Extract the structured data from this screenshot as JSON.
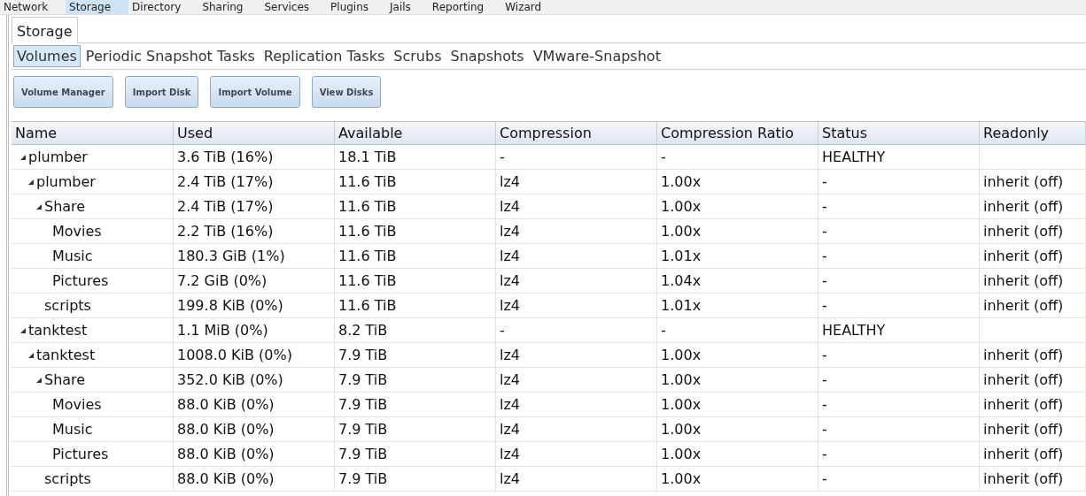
{
  "top_nav": [
    {
      "label": "Network",
      "selected": false
    },
    {
      "label": "Storage",
      "selected": true
    },
    {
      "label": "Directory",
      "selected": false
    },
    {
      "label": "Sharing",
      "selected": false
    },
    {
      "label": "Services",
      "selected": false
    },
    {
      "label": "Plugins",
      "selected": false
    },
    {
      "label": "Jails",
      "selected": false
    },
    {
      "label": "Reporting",
      "selected": false
    },
    {
      "label": "Wizard",
      "selected": false
    }
  ],
  "page_tab": {
    "label": "Storage"
  },
  "tabs": [
    {
      "label": "Volumes",
      "selected": true
    },
    {
      "label": "Periodic Snapshot Tasks",
      "selected": false
    },
    {
      "label": "Replication Tasks",
      "selected": false
    },
    {
      "label": "Scrubs",
      "selected": false
    },
    {
      "label": "Snapshots",
      "selected": false
    },
    {
      "label": "VMware-Snapshot",
      "selected": false
    }
  ],
  "buttons": [
    "Volume Manager",
    "Import Disk",
    "Import Volume",
    "View Disks"
  ],
  "table": {
    "columns": [
      "Name",
      "Used",
      "Available",
      "Compression",
      "Compression Ratio",
      "Status",
      "Readonly"
    ],
    "rows": [
      {
        "cells": [
          "plumber",
          "3.6 TiB (16%)",
          "18.1 TiB",
          "-",
          "-",
          "HEALTHY",
          ""
        ],
        "expanded": true,
        "children": [
          {
            "cells": [
              "plumber",
              "2.4 TiB (17%)",
              "11.6 TiB",
              "lz4",
              "1.00x",
              "-",
              "inherit (off)"
            ],
            "expanded": true,
            "children": [
              {
                "cells": [
                  "Share",
                  "2.4 TiB (17%)",
                  "11.6 TiB",
                  "lz4",
                  "1.00x",
                  "-",
                  "inherit (off)"
                ],
                "expanded": true,
                "children": [
                  {
                    "cells": [
                      "Movies",
                      "2.2 TiB (16%)",
                      "11.6 TiB",
                      "lz4",
                      "1.00x",
                      "-",
                      "inherit (off)"
                    ]
                  },
                  {
                    "cells": [
                      "Music",
                      "180.3 GiB (1%)",
                      "11.6 TiB",
                      "lz4",
                      "1.01x",
                      "-",
                      "inherit (off)"
                    ]
                  },
                  {
                    "cells": [
                      "Pictures",
                      "7.2 GiB (0%)",
                      "11.6 TiB",
                      "lz4",
                      "1.04x",
                      "-",
                      "inherit (off)"
                    ]
                  }
                ]
              },
              {
                "cells": [
                  "scripts",
                  "199.8 KiB (0%)",
                  "11.6 TiB",
                  "lz4",
                  "1.01x",
                  "-",
                  "inherit (off)"
                ]
              }
            ]
          }
        ]
      },
      {
        "cells": [
          "tanktest",
          "1.1 MiB (0%)",
          "8.2 TiB",
          "-",
          "-",
          "HEALTHY",
          ""
        ],
        "expanded": true,
        "children": [
          {
            "cells": [
              "tanktest",
              "1008.0 KiB (0%)",
              "7.9 TiB",
              "lz4",
              "1.00x",
              "-",
              "inherit (off)"
            ],
            "expanded": true,
            "children": [
              {
                "cells": [
                  "Share",
                  "352.0 KiB (0%)",
                  "7.9 TiB",
                  "lz4",
                  "1.00x",
                  "-",
                  "inherit (off)"
                ],
                "expanded": true,
                "children": [
                  {
                    "cells": [
                      "Movies",
                      "88.0 KiB (0%)",
                      "7.9 TiB",
                      "lz4",
                      "1.00x",
                      "-",
                      "inherit (off)"
                    ]
                  },
                  {
                    "cells": [
                      "Music",
                      "88.0 KiB (0%)",
                      "7.9 TiB",
                      "lz4",
                      "1.00x",
                      "-",
                      "inherit (off)"
                    ]
                  },
                  {
                    "cells": [
                      "Pictures",
                      "88.0 KiB (0%)",
                      "7.9 TiB",
                      "lz4",
                      "1.00x",
                      "-",
                      "inherit (off)"
                    ]
                  }
                ]
              },
              {
                "cells": [
                  "scripts",
                  "88.0 KiB (0%)",
                  "7.9 TiB",
                  "lz4",
                  "1.00x",
                  "-",
                  "inherit (off)"
                ]
              }
            ]
          }
        ]
      }
    ]
  }
}
